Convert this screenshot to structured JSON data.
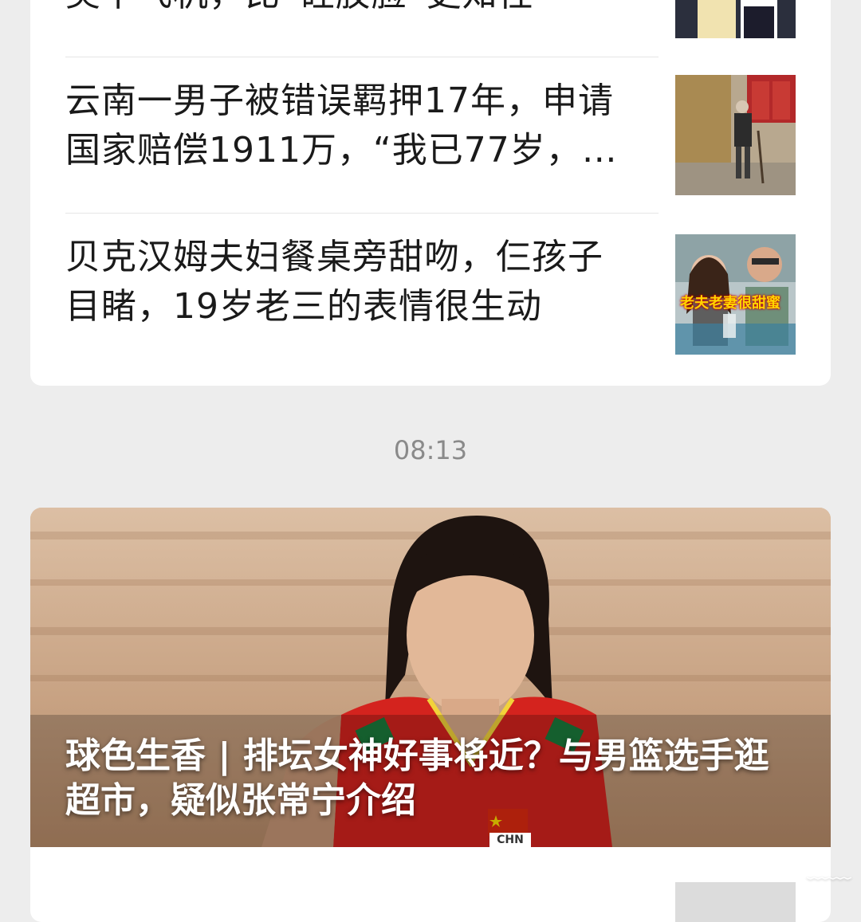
{
  "feed": {
    "items": [
      {
        "title": "美下飞机，比“硅胶脸”更知性",
        "thumb_icon": "women-photo-thumbnail"
      },
      {
        "title": "云南一男子被错误羁押17年，申请国家赔偿1911万，“我已77岁，…",
        "thumb_icon": "old-man-walking-thumbnail"
      },
      {
        "title": "贝克汉姆夫妇餐桌旁甜吻，仨孩子目睹，19岁老三的表情很生动",
        "thumb_icon": "beckham-couple-thumbnail",
        "thumb_caption": "老夫老妻很甜蜜"
      }
    ],
    "timestamp": "08:13",
    "feature": {
      "title": "球色生香 | 排坛女神好事将近？与男篮选手逛超市，疑似张常宁介绍",
      "hero_icon": "volleyball-player-photo",
      "jersey_text": "CHN"
    }
  },
  "colors": {
    "background": "#ededed",
    "card": "#ffffff",
    "title_text": "#1a1a1a",
    "time_text": "#8a8a8a",
    "jersey_red": "#d4231e"
  }
}
